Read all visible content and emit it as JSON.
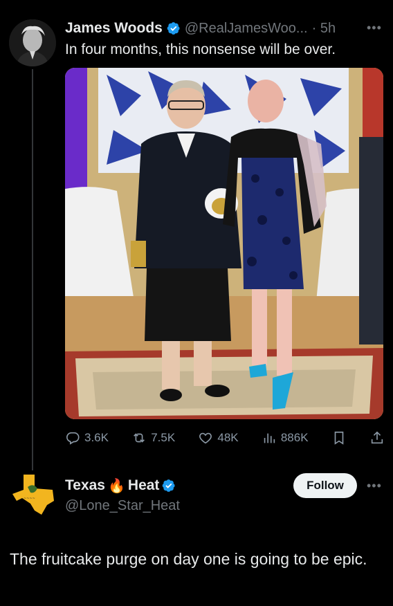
{
  "tweet": {
    "author_name": "James Woods",
    "author_handle": "@RealJamesWoo...",
    "time": "· 5h",
    "text": "In four months, this nonsense will be over.",
    "stats": {
      "replies": "3.6K",
      "reposts": "7.5K",
      "likes": "48K",
      "views": "886K"
    }
  },
  "reply": {
    "author_name_part1": "Texas",
    "author_name_emoji": "🔥",
    "author_name_part2": "Heat",
    "author_handle": "@Lone_Star_Heat",
    "follow_label": "Follow",
    "text": "The fruitcake purge on day one is going to be epic."
  },
  "colors": {
    "background": "#000000",
    "verified_blue": "#1d9bf0",
    "secondary_text": "#71767b",
    "icon_gray": "#8b98a5"
  },
  "icons": [
    "verified-icon",
    "more-icon",
    "reply-icon",
    "repost-icon",
    "like-icon",
    "views-icon",
    "bookmark-icon",
    "share-icon"
  ]
}
